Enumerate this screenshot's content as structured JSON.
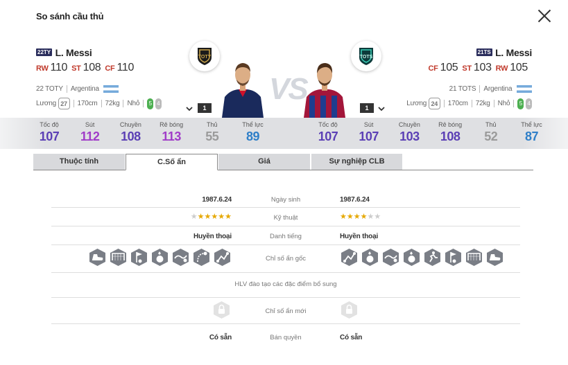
{
  "dialog": {
    "title": "So sánh cầu thủ",
    "vs_text": "VS"
  },
  "left_player": {
    "season": "22TY",
    "season_color": "#2a2d5c",
    "name": "L. Messi",
    "positions": [
      {
        "pos": "RW",
        "rating": "110"
      },
      {
        "pos": "ST",
        "rating": "108"
      },
      {
        "pos": "CF",
        "rating": "110"
      }
    ],
    "season_name": "22 TOTY",
    "nation": "Argentina",
    "salary_label": "Lương",
    "salary": "27",
    "height": "170cm",
    "weight": "72kg",
    "body": "Nhỏ",
    "foot_left": "5",
    "foot_right": "4",
    "club_badge": "TOTY",
    "card_count": "1",
    "stats": [
      {
        "label": "Tốc độ",
        "value": "107",
        "color": "#5b3fb5"
      },
      {
        "label": "Sút",
        "value": "112",
        "color": "#a03cc8"
      },
      {
        "label": "Chuyền",
        "value": "108",
        "color": "#5b3fb5"
      },
      {
        "label": "Rê bóng",
        "value": "113",
        "color": "#a03cc8"
      },
      {
        "label": "Thủ",
        "value": "55",
        "color": "#9a9a9a"
      },
      {
        "label": "Thể lực",
        "value": "89",
        "color": "#2f7fc8"
      }
    ]
  },
  "right_player": {
    "season": "21TS",
    "season_color": "#2a2d5c",
    "name": "L. Messi",
    "positions": [
      {
        "pos": "CF",
        "rating": "105"
      },
      {
        "pos": "ST",
        "rating": "103"
      },
      {
        "pos": "RW",
        "rating": "105"
      }
    ],
    "season_name": "21 TOTS",
    "nation": "Argentina",
    "salary_label": "Lương",
    "salary": "24",
    "height": "170cm",
    "weight": "72kg",
    "body": "Nhỏ",
    "foot_left": "5",
    "foot_right": "4",
    "club_badge": "TOTS",
    "card_count": "1",
    "stats": [
      {
        "label": "Tốc độ",
        "value": "107",
        "color": "#5b3fb5"
      },
      {
        "label": "Sút",
        "value": "107",
        "color": "#5b3fb5"
      },
      {
        "label": "Chuyền",
        "value": "103",
        "color": "#5b3fb5"
      },
      {
        "label": "Rê bóng",
        "value": "108",
        "color": "#5b3fb5"
      },
      {
        "label": "Thủ",
        "value": "52",
        "color": "#9a9a9a"
      },
      {
        "label": "Thể lực",
        "value": "87",
        "color": "#2f7fc8"
      }
    ]
  },
  "tabs": [
    {
      "label": "Thuộc tính",
      "active": false
    },
    {
      "label": "C.Số ẩn",
      "active": true
    },
    {
      "label": "Giá",
      "active": false
    },
    {
      "label": "Sự nghiệp CLB",
      "active": false
    }
  ],
  "rows": {
    "birth": {
      "label": "Ngày sinh",
      "left": "1987.6.24",
      "right": "1987.6.24"
    },
    "skill": {
      "label": "Kỹ thuật",
      "left_stars": 5,
      "right_stars": 4,
      "max": 6
    },
    "fame": {
      "label": "Danh tiếng",
      "left": "Huyền thoại",
      "right": "Huyền thoại"
    },
    "traits": {
      "label": "Chỉ số ẩn gốc",
      "left_icons": [
        "boot-icon",
        "goal-icon",
        "flag-icon",
        "ball-icon",
        "dribble-icon",
        "curve-icon",
        "pass-icon"
      ],
      "right_icons": [
        "pass-icon",
        "ball-icon",
        "dribble-icon",
        "ball-icon",
        "run-icon",
        "flag-icon",
        "goal-icon",
        "boot-icon"
      ]
    },
    "trainer": {
      "label": "HLV đào tạo các đặc điểm bổ sung"
    },
    "new_traits": {
      "label": "Chỉ số ẩn mới"
    },
    "availability": {
      "label": "Bán quyền",
      "left": "Có sẵn",
      "right": "Có sẵn"
    }
  }
}
